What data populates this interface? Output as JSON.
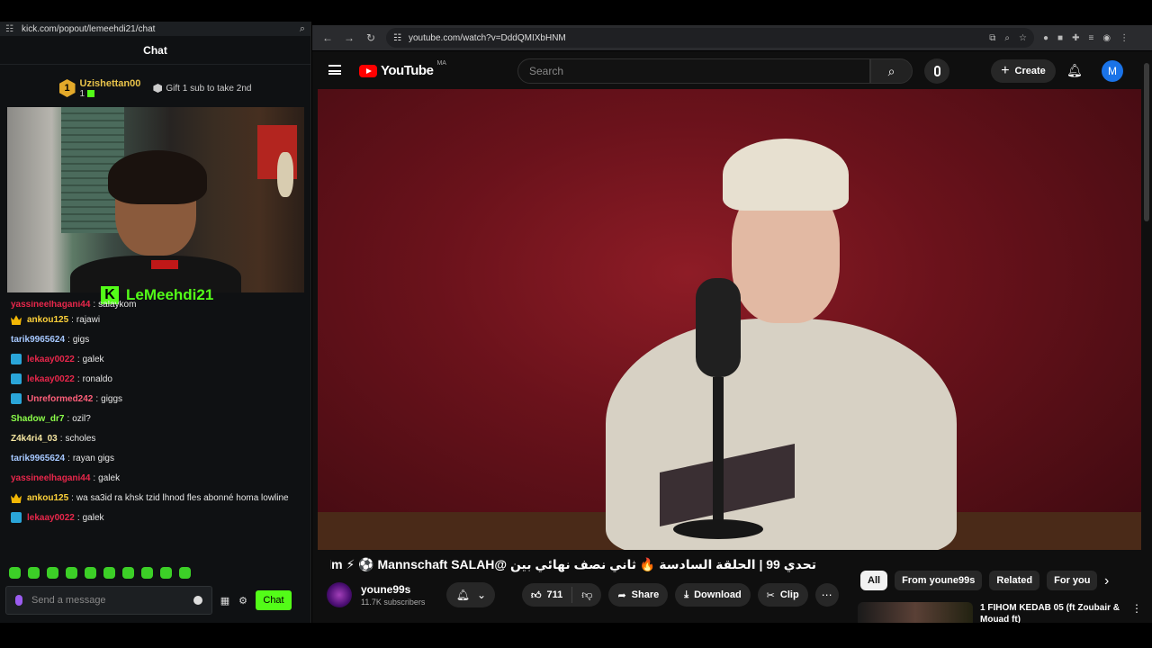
{
  "kick": {
    "url": "kick.com/popout/lemeehdi21/chat",
    "header": "Chat",
    "leader": {
      "rank": "1",
      "name": "Uzishettan00",
      "count": "1",
      "gift_text": "Gift 1 sub to take 2nd"
    },
    "streamer": "LeMeehdi21",
    "messages": [
      {
        "user": "yassineelhagani44",
        "text": "salaykom",
        "color": "#e8274b",
        "badge": ""
      },
      {
        "user": "ankou125",
        "text": "rajawi",
        "color": "#ffd23a",
        "badge": "crown"
      },
      {
        "user": "tarik9965624",
        "text": "gigs",
        "color": "#a6c8ff",
        "badge": ""
      },
      {
        "user": "lekaay0022",
        "text": "galek",
        "color": "#e8274b",
        "badge": "sub"
      },
      {
        "user": "lekaay0022",
        "text": "ronaldo",
        "color": "#e8274b",
        "badge": "sub"
      },
      {
        "user": "Unreformed242",
        "text": "giggs",
        "color": "#ff5f7a",
        "badge": "sub"
      },
      {
        "user": "Shadow_dr7",
        "text": "ozil?",
        "color": "#8cff4a",
        "badge": ""
      },
      {
        "user": "Z4k4ri4_03",
        "text": "scholes",
        "color": "#f5e6a0",
        "badge": ""
      },
      {
        "user": "tarik9965624",
        "text": "rayan gigs",
        "color": "#a6c8ff",
        "badge": ""
      },
      {
        "user": "yassineelhagani44",
        "text": "galek",
        "color": "#e8274b",
        "badge": ""
      },
      {
        "user": "ankou125",
        "text": "wa sa3id ra khsk tzid lhnod fles abonné homa lowline",
        "color": "#ffd23a",
        "badge": "crown"
      },
      {
        "user": "lekaay0022",
        "text": "galek",
        "color": "#e8274b",
        "badge": "sub"
      }
    ],
    "input_placeholder": "Send a message",
    "chat_button": "Chat"
  },
  "browser": {
    "url": "youtube.com/watch?v=DddQMIXbHNM"
  },
  "youtube": {
    "logo_text": "YouTube",
    "country": "MA",
    "search_placeholder": "Search",
    "create_label": "Create",
    "avatar_letter": "M",
    "video_title": "تحدي 99 | الحلقة السادسة 🔥 ثاني نصف نهائي بين @MehdiHilm ⚡ ⚽ Mannschaft SALAH و",
    "channel_name": "youne99s",
    "subscribers": "11.7K subscribers",
    "likes": "711",
    "share_label": "Share",
    "download_label": "Download",
    "clip_label": "Clip",
    "chips": [
      "All",
      "From youne99s",
      "Related",
      "For you"
    ],
    "rec_title": "1 FIHOM KEDAB 05 (ft Zoubair & Mouad ft)"
  }
}
